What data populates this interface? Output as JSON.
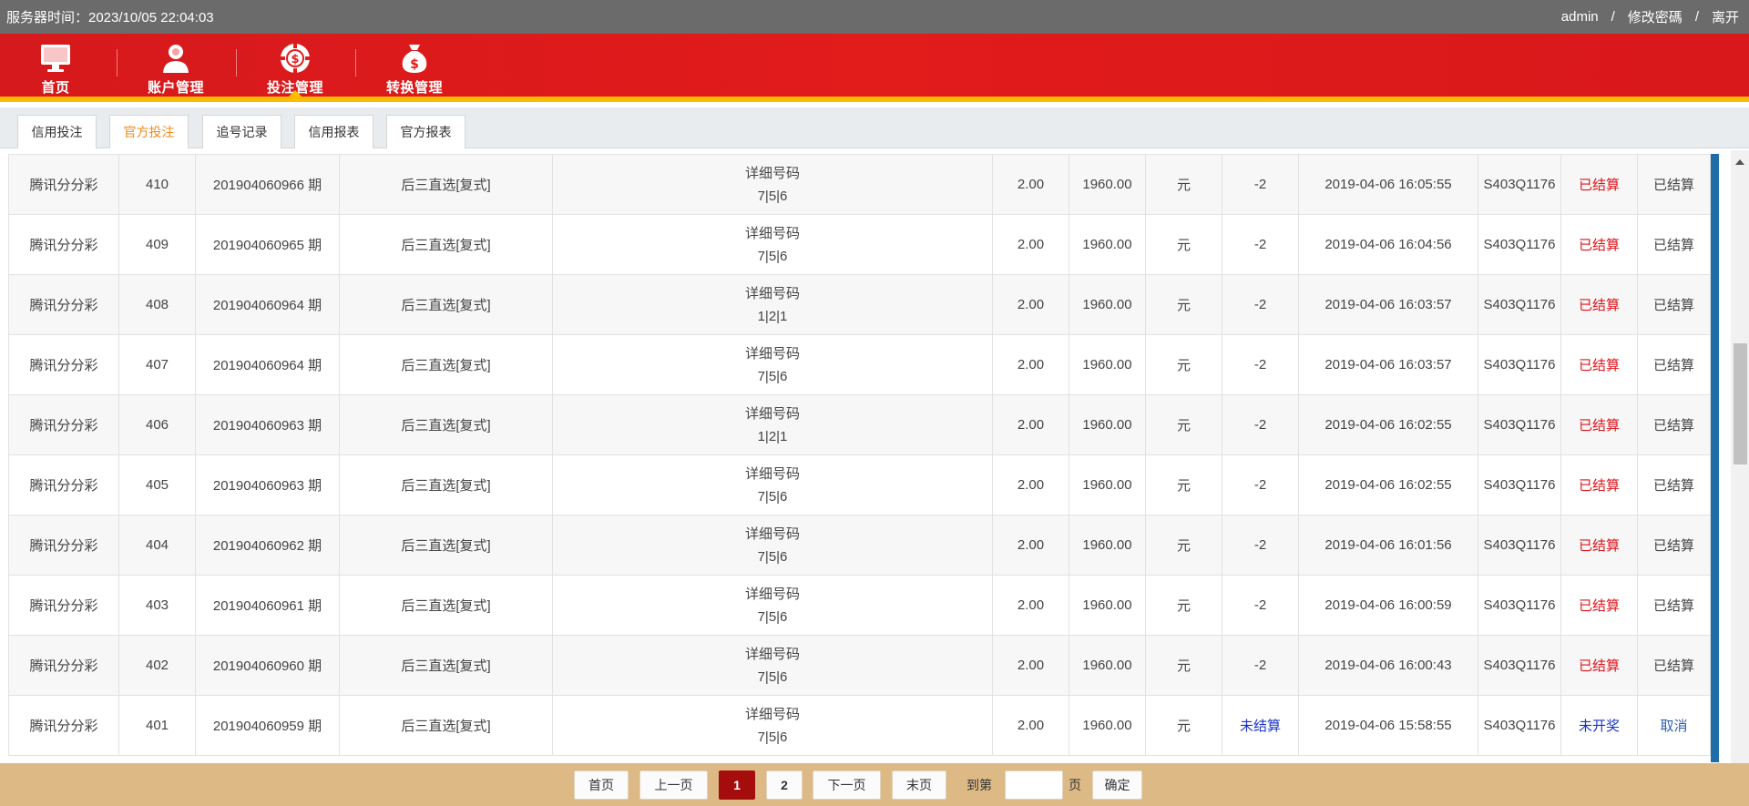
{
  "topbar": {
    "server_time": "服务器时间：2023/10/05 22:04:03",
    "user": "admin",
    "change_password": "修改密碼",
    "logout": "离开",
    "separator": "/"
  },
  "nav": [
    {
      "label": "首页",
      "icon": "monitor-icon"
    },
    {
      "label": "账户管理",
      "icon": "user-icon"
    },
    {
      "label": "投注管理",
      "icon": "poker-chip-icon",
      "active": true
    },
    {
      "label": "转换管理",
      "icon": "money-bag-icon"
    }
  ],
  "subtabs": [
    {
      "label": "信用投注"
    },
    {
      "label": "官方投注",
      "active": true
    },
    {
      "label": "追号记录"
    },
    {
      "label": "信用报表"
    },
    {
      "label": "官方报表"
    }
  ],
  "rows": [
    {
      "game": "腾讯分分彩",
      "id": "410",
      "period": "201904060966 期",
      "play": "后三直选[复式]",
      "detail": "详细号码",
      "numbers": "7|5|6",
      "multiple": "2.00",
      "amount": "1960.00",
      "unit": "元",
      "result": "-2",
      "time": "2019-04-06 16:05:55",
      "order": "S403Q1176",
      "status": "已结算",
      "action": "已结算"
    },
    {
      "game": "腾讯分分彩",
      "id": "409",
      "period": "201904060965 期",
      "play": "后三直选[复式]",
      "detail": "详细号码",
      "numbers": "7|5|6",
      "multiple": "2.00",
      "amount": "1960.00",
      "unit": "元",
      "result": "-2",
      "time": "2019-04-06 16:04:56",
      "order": "S403Q1176",
      "status": "已结算",
      "action": "已结算"
    },
    {
      "game": "腾讯分分彩",
      "id": "408",
      "period": "201904060964 期",
      "play": "后三直选[复式]",
      "detail": "详细号码",
      "numbers": "1|2|1",
      "multiple": "2.00",
      "amount": "1960.00",
      "unit": "元",
      "result": "-2",
      "time": "2019-04-06 16:03:57",
      "order": "S403Q1176",
      "status": "已结算",
      "action": "已结算"
    },
    {
      "game": "腾讯分分彩",
      "id": "407",
      "period": "201904060964 期",
      "play": "后三直选[复式]",
      "detail": "详细号码",
      "numbers": "7|5|6",
      "multiple": "2.00",
      "amount": "1960.00",
      "unit": "元",
      "result": "-2",
      "time": "2019-04-06 16:03:57",
      "order": "S403Q1176",
      "status": "已结算",
      "action": "已结算"
    },
    {
      "game": "腾讯分分彩",
      "id": "406",
      "period": "201904060963 期",
      "play": "后三直选[复式]",
      "detail": "详细号码",
      "numbers": "1|2|1",
      "multiple": "2.00",
      "amount": "1960.00",
      "unit": "元",
      "result": "-2",
      "time": "2019-04-06 16:02:55",
      "order": "S403Q1176",
      "status": "已结算",
      "action": "已结算"
    },
    {
      "game": "腾讯分分彩",
      "id": "405",
      "period": "201904060963 期",
      "play": "后三直选[复式]",
      "detail": "详细号码",
      "numbers": "7|5|6",
      "multiple": "2.00",
      "amount": "1960.00",
      "unit": "元",
      "result": "-2",
      "time": "2019-04-06 16:02:55",
      "order": "S403Q1176",
      "status": "已结算",
      "action": "已结算"
    },
    {
      "game": "腾讯分分彩",
      "id": "404",
      "period": "201904060962 期",
      "play": "后三直选[复式]",
      "detail": "详细号码",
      "numbers": "7|5|6",
      "multiple": "2.00",
      "amount": "1960.00",
      "unit": "元",
      "result": "-2",
      "time": "2019-04-06 16:01:56",
      "order": "S403Q1176",
      "status": "已结算",
      "action": "已结算"
    },
    {
      "game": "腾讯分分彩",
      "id": "403",
      "period": "201904060961 期",
      "play": "后三直选[复式]",
      "detail": "详细号码",
      "numbers": "7|5|6",
      "multiple": "2.00",
      "amount": "1960.00",
      "unit": "元",
      "result": "-2",
      "time": "2019-04-06 16:00:59",
      "order": "S403Q1176",
      "status": "已结算",
      "action": "已结算"
    },
    {
      "game": "腾讯分分彩",
      "id": "402",
      "period": "201904060960 期",
      "play": "后三直选[复式]",
      "detail": "详细号码",
      "numbers": "7|5|6",
      "multiple": "2.00",
      "amount": "1960.00",
      "unit": "元",
      "result": "-2",
      "time": "2019-04-06 16:00:43",
      "order": "S403Q1176",
      "status": "已结算",
      "action": "已结算"
    },
    {
      "game": "腾讯分分彩",
      "id": "401",
      "period": "201904060959 期",
      "play": "后三直选[复式]",
      "detail": "详细号码",
      "numbers": "7|5|6",
      "multiple": "2.00",
      "amount": "1960.00",
      "unit": "元",
      "result": "未结算",
      "time": "2019-04-06 15:58:55",
      "order": "S403Q1176",
      "status": "未开奖",
      "action": "取消",
      "pending": true
    }
  ],
  "pager": {
    "first": "首页",
    "prev": "上一页",
    "page1": "1",
    "page2": "2",
    "next": "下一页",
    "last": "末页",
    "goto_label": "到第",
    "page_unit": "页",
    "confirm": "确定"
  },
  "colors": {
    "topbar": "#6b6b6b",
    "nav_red": "#e21b1b",
    "nav_underline": "#ffc000",
    "active_tab": "#f08a1a",
    "status_red": "#e0141b",
    "pending_blue": "#1a33c8",
    "pager_bg": "#ddb985",
    "current_page": "#a50d0d"
  }
}
